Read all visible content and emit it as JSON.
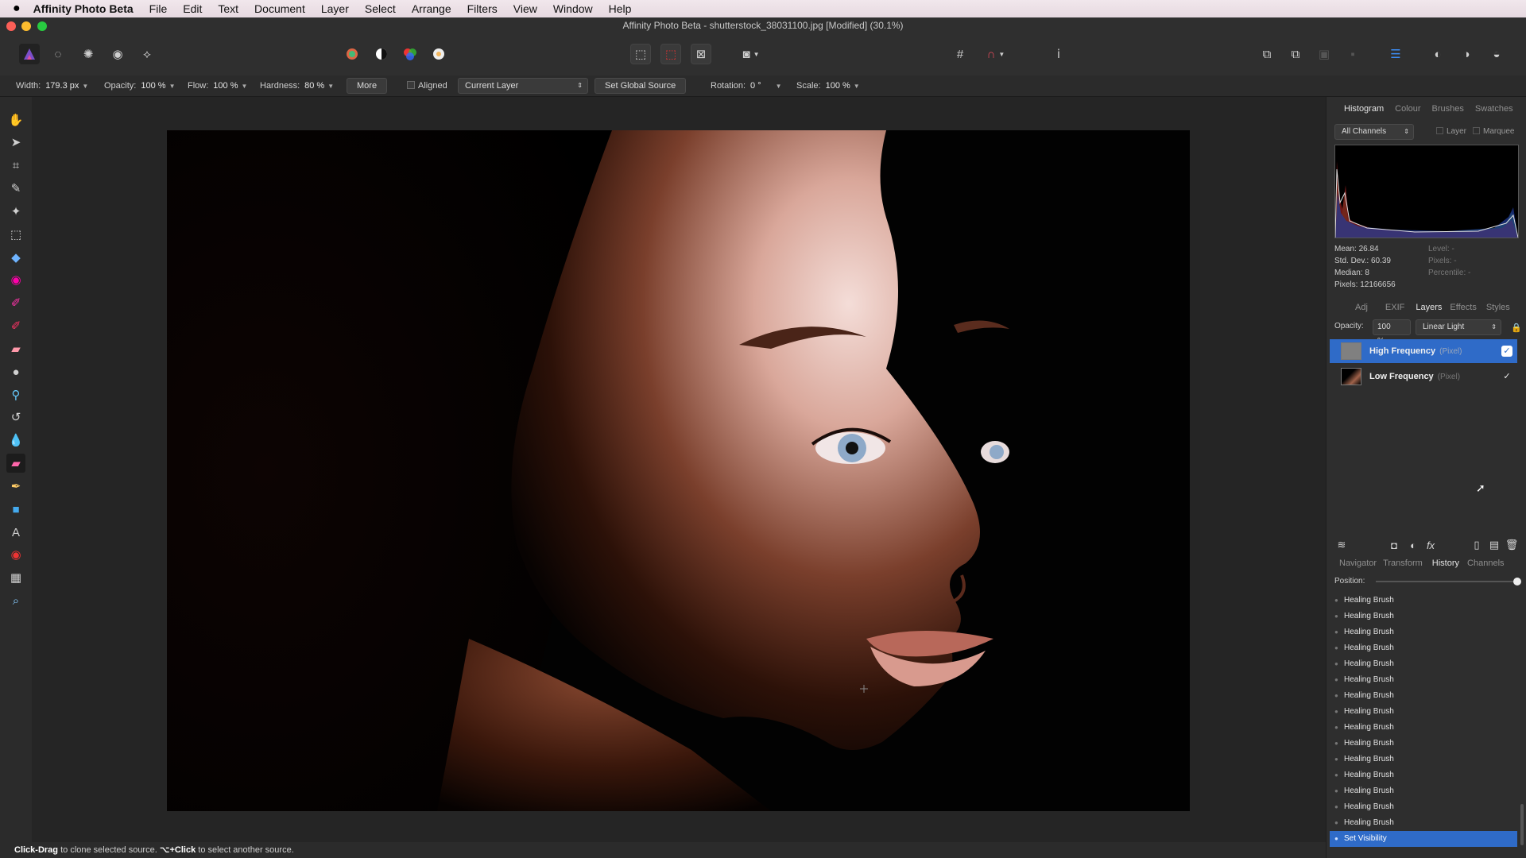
{
  "menubar": {
    "app_name": "Affinity Photo Beta",
    "items": [
      "File",
      "Edit",
      "Text",
      "Document",
      "Layer",
      "Select",
      "Arrange",
      "Filters",
      "View",
      "Window",
      "Help"
    ]
  },
  "window": {
    "title": "Affinity Photo Beta - shutterstock_38031100.jpg [Modified] (30.1%)"
  },
  "context_toolbar": {
    "width_label": "Width:",
    "width_value": "179.3 px",
    "opacity_label": "Opacity:",
    "opacity_value": "100 %",
    "flow_label": "Flow:",
    "flow_value": "100 %",
    "hardness_label": "Hardness:",
    "hardness_value": "80 %",
    "more_button": "More",
    "aligned_label": "Aligned",
    "source_select": "Current Layer",
    "set_global_source_button": "Set Global Source",
    "rotation_label": "Rotation:",
    "rotation_value": "0 °",
    "scale_label": "Scale:",
    "scale_value": "100 %"
  },
  "right_panel": {
    "top_tabs": [
      "Histogram",
      "Colour",
      "Brushes",
      "Swatches"
    ],
    "channels_select": "All Channels",
    "layer_checkbox_label": "Layer",
    "marquee_checkbox_label": "Marquee",
    "stats_left": [
      "Mean: 26.84",
      "Std. Dev.: 60.39",
      "Median: 8",
      "Pixels: 12166656"
    ],
    "stats_right": [
      "Level: -",
      "Pixels: -",
      "Percentile: -"
    ],
    "mid_tabs": [
      "Adj",
      "EXIF",
      "Layers",
      "Effects",
      "Styles"
    ],
    "layers_opacity_label": "Opacity:",
    "layers_opacity_value": "100 %",
    "blend_mode": "Linear Light",
    "layers": [
      {
        "name": "High Frequency",
        "type": "(Pixel)"
      },
      {
        "name": "Low Frequency",
        "type": "(Pixel)"
      }
    ],
    "bottom_tabs": [
      "Navigator",
      "Transform",
      "History",
      "Channels"
    ],
    "position_label": "Position:",
    "history_items": [
      "Healing Brush",
      "Healing Brush",
      "Healing Brush",
      "Healing Brush",
      "Healing Brush",
      "Healing Brush",
      "Healing Brush",
      "Healing Brush",
      "Healing Brush",
      "Healing Brush",
      "Healing Brush",
      "Healing Brush",
      "Healing Brush",
      "Healing Brush",
      "Healing Brush",
      "Set Visibility"
    ]
  },
  "status_bar": {
    "action1": "Click-Drag",
    "text1": " to clone selected source. ",
    "action2": "⌥+Click",
    "text2": " to select another source."
  },
  "colors": {
    "accent": "#2f6bc8",
    "panel_bg": "#2e2e2e",
    "canvas_bg": "#252525"
  }
}
